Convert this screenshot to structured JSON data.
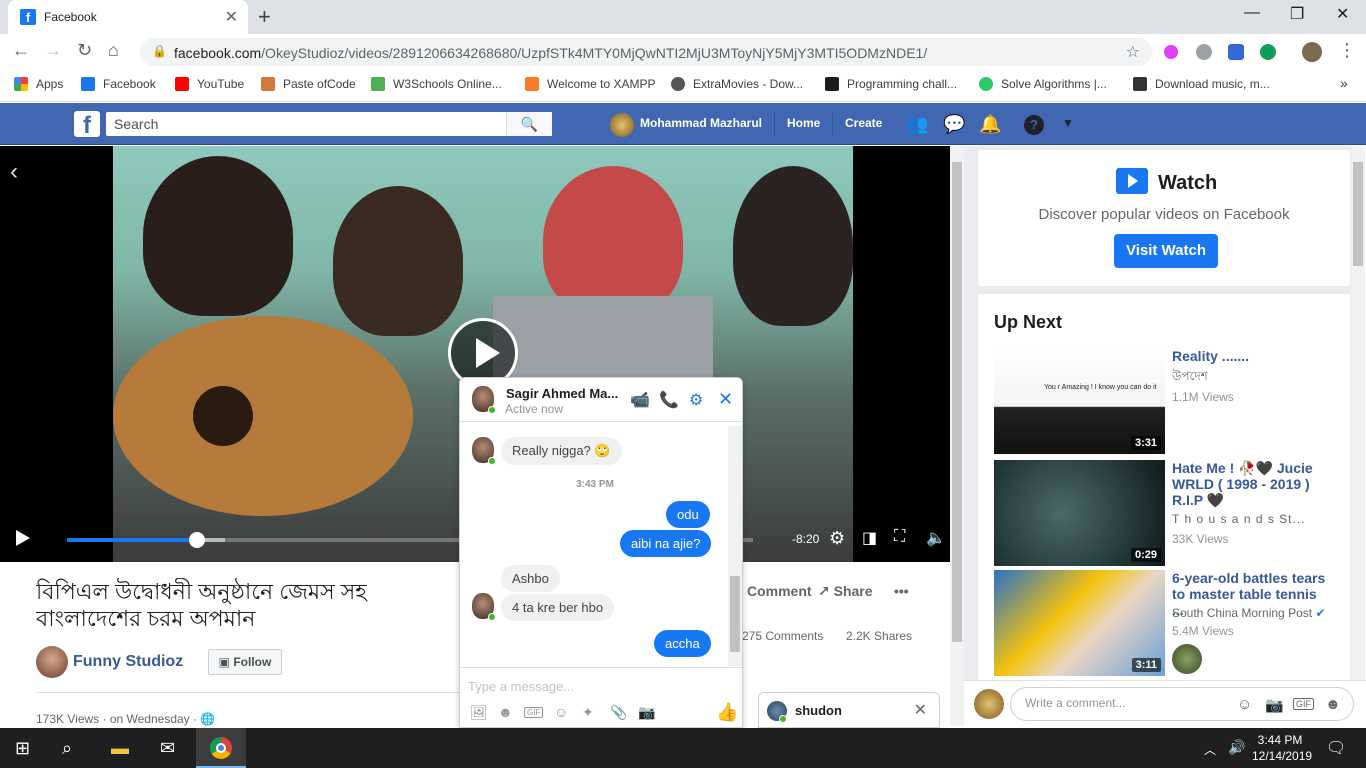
{
  "browser": {
    "tab_title": "Facebook",
    "url_domain": "facebook.com",
    "url_path": "/OkeyStudioz/videos/2891206634268680/UzpfSTk4MTY0MjQwNTI2MjU3MToyNjY5MjY3MTI5ODMzNDE1/",
    "bookmarks": [
      {
        "label": "Apps",
        "color": "#4285f4"
      },
      {
        "label": "Facebook",
        "color": "#1877f2"
      },
      {
        "label": "YouTube",
        "color": "#ff0000"
      },
      {
        "label": "Paste ofCode",
        "color": "#d07a3c"
      },
      {
        "label": "W3Schools Online...",
        "color": "#4caf50"
      },
      {
        "label": "Welcome to XAMPP",
        "color": "#fb7a24"
      },
      {
        "label": "ExtraMovies - Dow...",
        "color": "#555555"
      },
      {
        "label": "Programming chall...",
        "color": "#1c1c1c"
      },
      {
        "label": "Solve Algorithms |...",
        "color": "#2ec866"
      },
      {
        "label": "Download music, m...",
        "color": "#333333"
      }
    ]
  },
  "fb": {
    "search_placeholder": "Search",
    "user_name": "Mohammad Mazharul",
    "nav_home": "Home",
    "nav_create": "Create"
  },
  "video": {
    "time_remaining": "-8:20",
    "progress": 0.19,
    "buffered": 0.23
  },
  "post": {
    "title": "বিপিএল উদ্বোধনী অনুষ্ঠানে জেমস সহ বাংলাদেশের চরম অপমান",
    "page_name": "Funny Studioz",
    "follow_label": "Follow",
    "views": "173K Views",
    "date": "· on Wednesday ·",
    "comment_label": "Comment",
    "share_label": "Share",
    "comments_count": "275 Comments",
    "shares_count": "2.2K Shares"
  },
  "watch": {
    "title": "Watch",
    "description": "Discover popular videos on Facebook",
    "button": "Visit Watch"
  },
  "up_next": {
    "title": "Up Next",
    "items": [
      {
        "title": "Reality .......",
        "source": "উপদেশ",
        "views": "1.1M Views",
        "duration": "3:31"
      },
      {
        "title": "Hate Me ! 🥀🖤 Jucie WRLD ( 1998 - 2019 ) R.I.P 🖤",
        "source": "T h o u s a n d s   St...",
        "views": "33K Views",
        "duration": "0:29"
      },
      {
        "title": "6-year-old battles tears to master table tennis ...",
        "source": "South China Morning Post",
        "views": "5.4M Views",
        "duration": "3:11"
      }
    ],
    "thumb1_caption": "You r Amazing ! I know you can do it"
  },
  "comment": {
    "placeholder": "Write a comment..."
  },
  "chat": {
    "name": "Sagir Ahmed Ma...",
    "status": "Active now",
    "time": "3:43 PM",
    "messages": {
      "m1": "Really nigga? 🙄",
      "m2": "odu",
      "m3": "aibi na ajie?",
      "m4": "Ashbo",
      "m5": "4 ta kre ber hbo",
      "m6": "accha"
    },
    "input_placeholder": "Type a message...",
    "minimized_name": "shudon"
  },
  "taskbar": {
    "time": "3:44 PM",
    "date": "12/14/2019"
  }
}
